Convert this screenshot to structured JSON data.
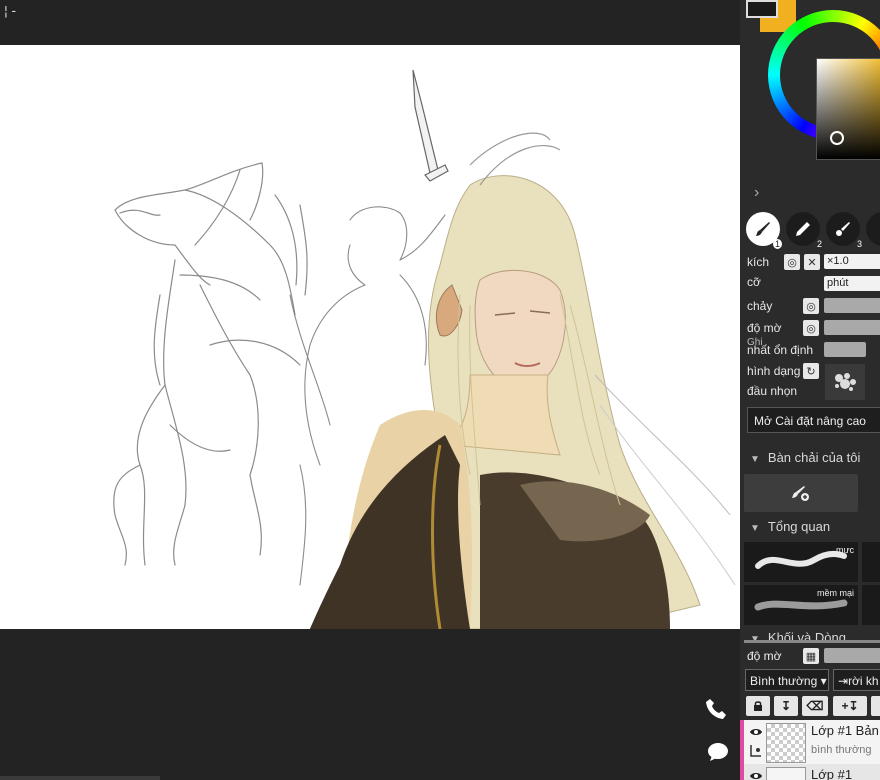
{
  "topbar": {
    "glyph": "¦-"
  },
  "colors": {
    "primary": "#1a1a1a",
    "secondary": "#f0b020"
  },
  "brush_tools": [
    {
      "num": "1",
      "icon": "brush-icon"
    },
    {
      "num": "2",
      "icon": "pencil-icon"
    },
    {
      "num": "3",
      "icon": "airbrush-icon"
    }
  ],
  "props": {
    "size_label_1": "kích",
    "size_label_2": "cỡ",
    "size_value": "×1.0",
    "size_unit": "phút",
    "flow_label": "chảy",
    "opacity_label": "độ mờ",
    "stabilize_label_a": "Ghi",
    "stabilize_label_b": "nhất ổn định",
    "tip_label_1": "hình dạng",
    "tip_label_2": "đầu nhọn",
    "advanced_button": "Mở Cài đặt nâng cao"
  },
  "sections": {
    "my_brushes": "Bàn chải của tôi",
    "overview": "Tổng quan",
    "blocks": "Khối và Dòng"
  },
  "brush_cards": [
    {
      "label": "mực"
    },
    {
      "label": "mềm mại"
    }
  ],
  "layers_panel": {
    "opacity_label": "độ mờ",
    "blend_mode": "Bình thường",
    "leave_button": "rời kh"
  },
  "layers": [
    {
      "name": "Lớp #1 Bản",
      "mode": "bình thường"
    },
    {
      "name": "Lớp #1",
      "mode": ""
    }
  ]
}
